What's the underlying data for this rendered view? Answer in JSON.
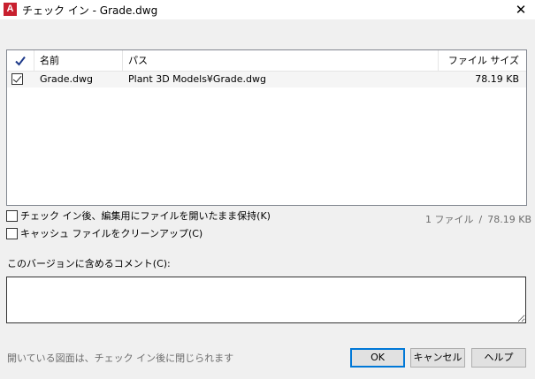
{
  "window": {
    "title": "チェック イン - Grade.dwg",
    "app_icon_letter": "A",
    "close_glyph": "✕"
  },
  "file_list": {
    "columns": {
      "check": "✓",
      "name": "名前",
      "path": "パス",
      "size": "ファイル サイズ"
    },
    "rows": [
      {
        "checked": true,
        "name": "Grade.dwg",
        "path": "Plant 3D Models¥Grade.dwg",
        "size": "78.19 KB"
      }
    ]
  },
  "options": {
    "keep_open_label": "チェック イン後、編集用にファイルを開いたまま保持(K)",
    "keep_open_checked": false,
    "cleanup_cache_label": "キャッシュ ファイルをクリーンアップ(C)",
    "cleanup_cache_checked": false
  },
  "summary": {
    "file_count": "1 ファイル",
    "separator": "/",
    "total_size": "78.19 KB"
  },
  "comment": {
    "label": "このバージョンに含めるコメント(C):",
    "value": ""
  },
  "footer": {
    "note": "開いている図面は、チェック イン後に閉じられます",
    "ok_label": "OK",
    "cancel_label": "キャンセル",
    "help_label": "ヘルプ"
  },
  "colors": {
    "app_icon": "#c8202f",
    "check_header": "#1e3a8a",
    "default_button_border": "#0078d7",
    "muted_text": "#6d6d6d"
  }
}
